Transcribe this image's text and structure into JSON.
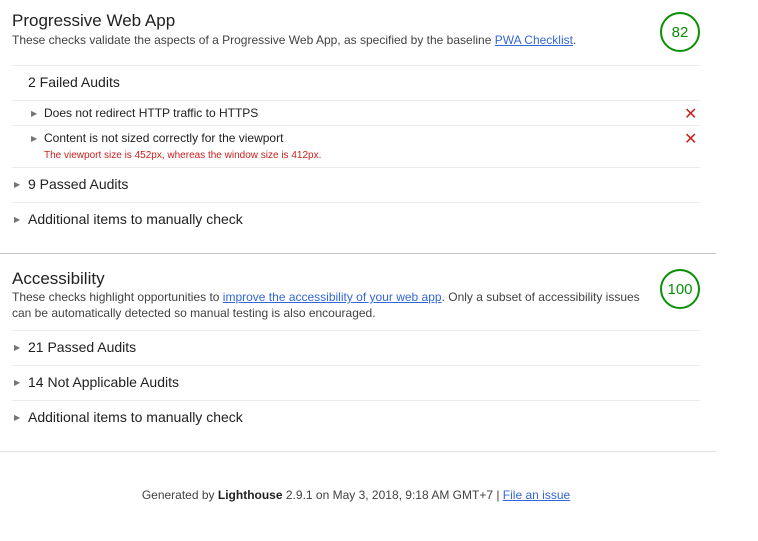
{
  "pwa": {
    "title": "Progressive Web App",
    "description": "These checks validate the aspects of a Progressive Web App, as specified by the baseline ",
    "link": "PWA Checklist",
    "description_end": ".",
    "score": "82",
    "failed_label": "2 Failed Audits",
    "failed_audits": [
      {
        "title": "Does not redirect HTTP traffic to HTTPS",
        "detail": ""
      },
      {
        "title": "Content is not sized correctly for the viewport",
        "detail": "The viewport size is 452px, whereas the window size is 412px."
      }
    ],
    "passed_label": "9 Passed Audits",
    "manual_label": "Additional items to manually check"
  },
  "a11y": {
    "title": "Accessibility",
    "description": "These checks highlight opportunities to ",
    "link": "improve the accessibility of your web app",
    "description_end": ". Only a subset of accessibility issues can be automatically detected so manual testing is also encouraged.",
    "score": "100",
    "passed_label": "21 Passed Audits",
    "not_applicable_label": "14 Not Applicable Audits",
    "manual_label": "Additional items to manually check"
  },
  "footer": {
    "prefix": "Generated by ",
    "brand": "Lighthouse",
    "version_date": " 2.9.1 on May 3, 2018, 9:18 AM GMT+7 | ",
    "link": "File an issue"
  },
  "icons": {
    "expand": "triangle-right-icon",
    "fail": "cross-icon"
  },
  "colors": {
    "pass_green": "#0a8f08",
    "fail_red": "#c7221f",
    "link_blue": "#3367d6"
  }
}
